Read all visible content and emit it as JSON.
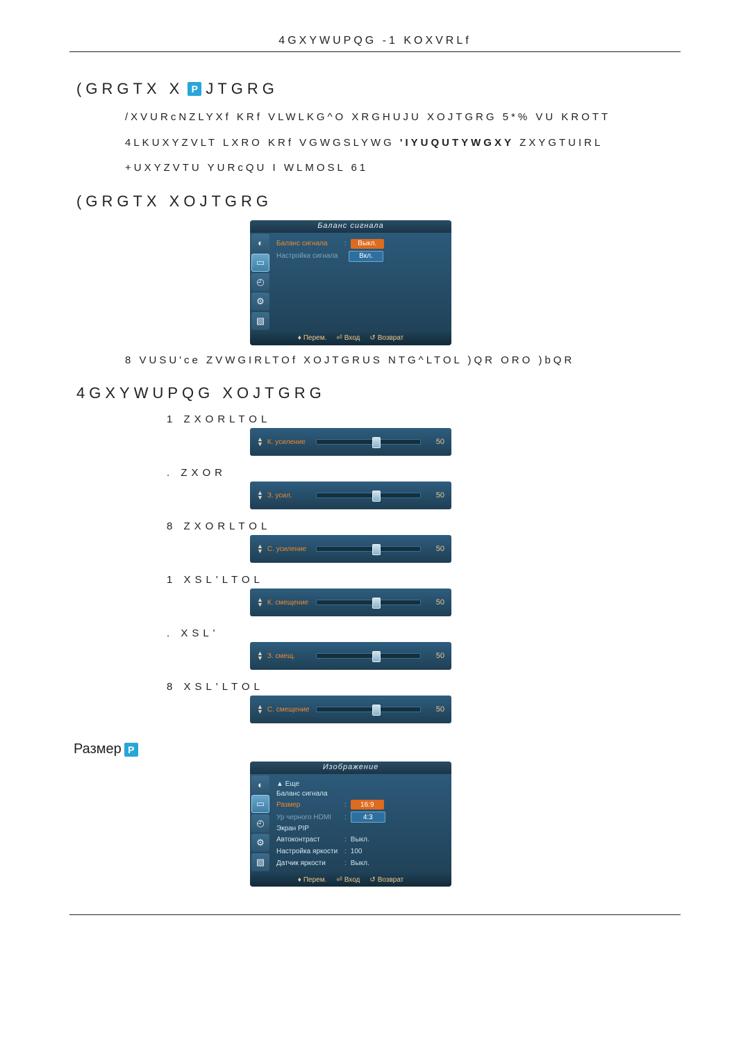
{
  "top_header": "4GXYWUPQG -1 KOXVRLf",
  "section1": {
    "title_before": "(GRGTX X",
    "badge": "P",
    "title_after": "JTGRG",
    "line1": "/XVURcNZLYXf KRf VLWLKG^O XRGHUJU XOJTGRG 5*% VU KROTT",
    "line2_a": "4LKUXYZVLT  LXRO KRf VGWGSLYWG ",
    "line2_b": "'IYUQUTYWGXY",
    "line2_c": " ZXYGTUIRL",
    "line3": "+UXYZVTU YURcQU I WLMOSL 61"
  },
  "section2": {
    "title": "(GRGTX XOJTGRG",
    "osd": {
      "title": "Баланс сигнала",
      "row1_label": "Баланс сигнала",
      "row1_opt": "Выкл.",
      "row2_label": "Настройка сигнала",
      "row2_opt": "Вкл.",
      "footer_move": "Перем.",
      "footer_enter": "Вход",
      "footer_return": "Возврат"
    },
    "caption": "8 VUSU'ce ZVWGIRLTOf XOJTGRUS NTG^LTOL )QR  ORO )bQR"
  },
  "section3": {
    "title": "4GXYWUPQG XOJTGRG",
    "items": [
      {
        "label": "1  ZXORLTOL",
        "slabel": "К. усиление",
        "value": "50",
        "thumb": 54
      },
      {
        "label": ".  ZXOR",
        "slabel": "З. усил.",
        "value": "50",
        "thumb": 54
      },
      {
        "label": "8  ZXORLTOL",
        "slabel": "С. усиление",
        "value": "50",
        "thumb": 54
      },
      {
        "label": "1  XSL'LTOL",
        "slabel": "К. смещение",
        "value": "50",
        "thumb": 54
      },
      {
        "label": ".  XSL'",
        "slabel": "З. смещ.",
        "value": "50",
        "thumb": 54
      },
      {
        "label": "8  XSL'LTOL",
        "slabel": "С. смещение",
        "value": "50",
        "thumb": 54
      }
    ]
  },
  "section4": {
    "title": "Размер",
    "badge": "P",
    "osd": {
      "title": "Изображение",
      "rows": [
        {
          "label": "▲ Еще",
          "value": ""
        },
        {
          "label": "Баланс сигнала",
          "value": ""
        },
        {
          "label": "Размер",
          "value": "16:9",
          "hl": "orange",
          "vhl": "orange"
        },
        {
          "label": "Ур черного HDMI",
          "value": "4:3",
          "hl": "dim",
          "vhl": "blue"
        },
        {
          "label": "Экран PIP",
          "value": ""
        },
        {
          "label": "Автоконтраст",
          "value": "Выкл."
        },
        {
          "label": "Настройка яркости",
          "value": "100"
        },
        {
          "label": "Датчик яркости",
          "value": "Выкл."
        }
      ],
      "footer_move": "Перем.",
      "footer_enter": "Вход",
      "footer_return": "Возврат"
    }
  }
}
